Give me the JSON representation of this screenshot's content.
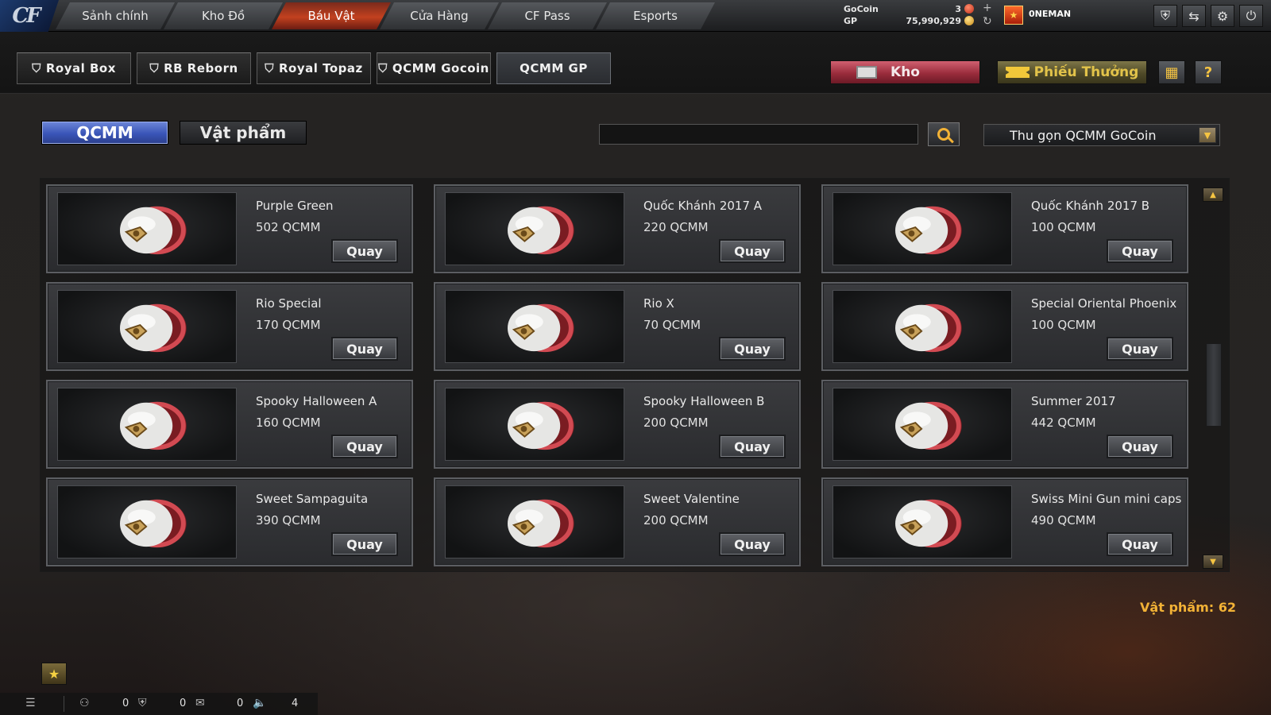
{
  "logo": "CF",
  "top_nav": {
    "tabs": [
      {
        "label": "Sảnh chính",
        "active": false
      },
      {
        "label": "Kho Đồ",
        "active": false
      },
      {
        "label": "Báu Vật",
        "active": true
      },
      {
        "label": "Cửa Hàng",
        "active": false
      },
      {
        "label": "CF Pass",
        "active": false
      },
      {
        "label": "Esports",
        "active": false
      }
    ],
    "currency": {
      "gocoin_label": "GoCoin",
      "gp_label": "GP",
      "gocoin_value": "3",
      "gp_value": "75,990,929"
    },
    "username": "0NEMAN",
    "system_buttons": [
      "shield-icon",
      "exit-icon",
      "gear-icon",
      "power-icon"
    ]
  },
  "sub_nav": {
    "tabs": [
      {
        "label": "Royal Box",
        "active": false
      },
      {
        "label": "RB Reborn",
        "active": false
      },
      {
        "label": "Royal Topaz",
        "active": false
      },
      {
        "label": "QCMM Gocoin",
        "active": false
      },
      {
        "label": "QCMM GP",
        "active": true
      }
    ],
    "kho_label": "Kho",
    "phieu_label": "Phiếu Thưởng",
    "grid_button": "grid-icon",
    "help_label": "?"
  },
  "filters": {
    "qcmm_label": "QCMM",
    "vatpham_label": "Vật phẩm",
    "search_value": "",
    "dropdown_value": "Thu gọn QCMM GoCoin"
  },
  "items": [
    {
      "name": "Purple Green",
      "price": "502 QCMM",
      "button": "Quay"
    },
    {
      "name": "Quốc Khánh 2017 A",
      "price": "220 QCMM",
      "button": "Quay"
    },
    {
      "name": "Quốc Khánh 2017 B",
      "price": "100 QCMM",
      "button": "Quay"
    },
    {
      "name": "Rio Special",
      "price": "170 QCMM",
      "button": "Quay"
    },
    {
      "name": "Rio X",
      "price": "70 QCMM",
      "button": "Quay"
    },
    {
      "name": "Special Oriental Phoenix",
      "price": "100 QCMM",
      "button": "Quay"
    },
    {
      "name": "Spooky Halloween A",
      "price": "160 QCMM",
      "button": "Quay"
    },
    {
      "name": "Spooky Halloween B",
      "price": "200 QCMM",
      "button": "Quay"
    },
    {
      "name": "Summer 2017",
      "price": "442 QCMM",
      "button": "Quay"
    },
    {
      "name": "Sweet Sampaguita",
      "price": "390 QCMM",
      "button": "Quay"
    },
    {
      "name": "Sweet Valentine",
      "price": "200 QCMM",
      "button": "Quay"
    },
    {
      "name": "Swiss Mini Gun mini caps",
      "price": "490 QCMM",
      "button": "Quay"
    }
  ],
  "item_count_text": "Vật phẩm: 62",
  "status_bar": {
    "values": [
      "0",
      "0",
      "0",
      "4"
    ]
  },
  "colors": {
    "accent_orange": "#f2b236",
    "active_tab_red": "#c2411f",
    "filter_blue": "#3a55b8"
  }
}
